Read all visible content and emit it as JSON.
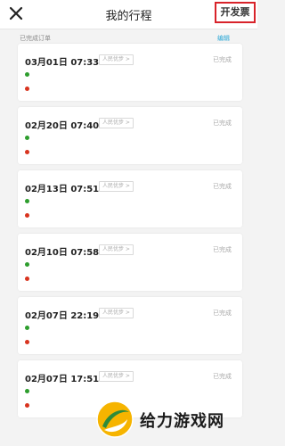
{
  "header": {
    "title": "我的行程",
    "invoice_label": "开发票"
  },
  "section": {
    "label": "已完成订单",
    "edit_label": "编辑"
  },
  "colors": {
    "start_dot": "#2e9e2e",
    "end_dot": "#d8341f",
    "highlight": "#d8232a",
    "link": "#2aa7d6"
  },
  "trips": [
    {
      "datetime": "03月01日 07:33",
      "tag": "人民优步 >",
      "status": "已完成"
    },
    {
      "datetime": "02月20日 07:40",
      "tag": "人民优步 >",
      "status": "已完成"
    },
    {
      "datetime": "02月13日 07:51",
      "tag": "人民优步 >",
      "status": "已完成"
    },
    {
      "datetime": "02月10日 07:58",
      "tag": "人民优步 >",
      "status": "已完成"
    },
    {
      "datetime": "02月07日 22:19",
      "tag": "人民优步 >",
      "status": "已完成"
    },
    {
      "datetime": "02月07日 17:51",
      "tag": "人民优步 >",
      "status": "已完成"
    }
  ],
  "watermark": {
    "text": "给力游戏网"
  }
}
